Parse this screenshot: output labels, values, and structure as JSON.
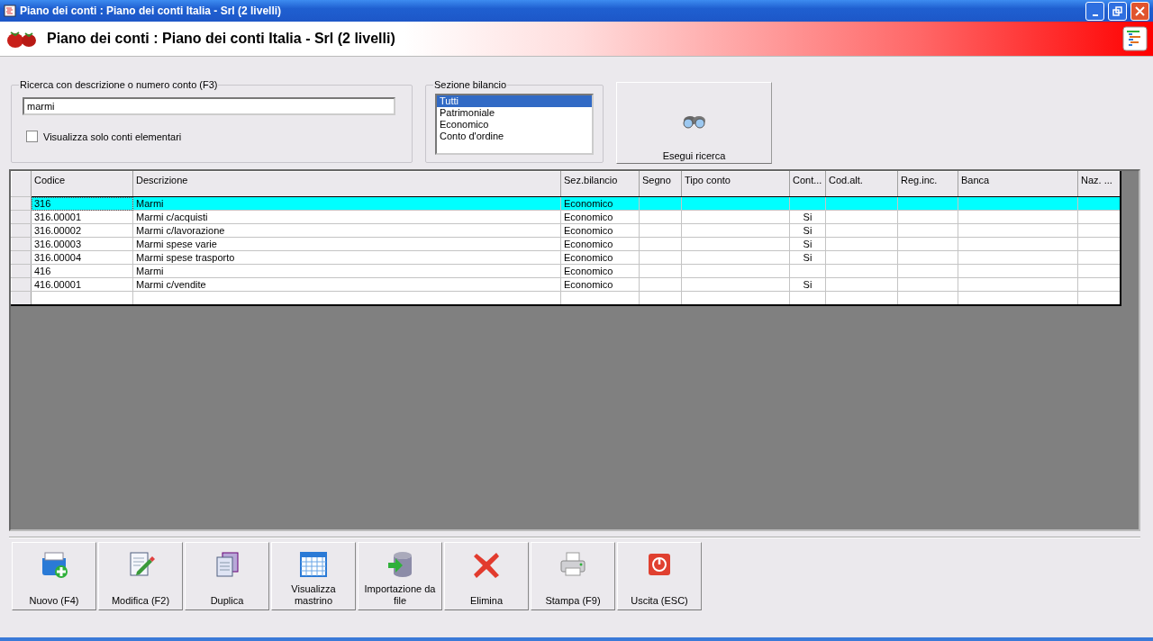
{
  "window": {
    "title": "Piano dei conti : Piano dei conti Italia - Srl (2 livelli)"
  },
  "header": {
    "title": "Piano dei conti : Piano dei conti Italia - Srl (2 livelli)"
  },
  "search": {
    "label": "Ricerca con descrizione o numero conto (F3)",
    "value": "marmi",
    "checkbox": {
      "label": "Visualizza solo conti elementari",
      "checked": false
    }
  },
  "section": {
    "label": "Sezione bilancio",
    "options": [
      {
        "label": "Tutti",
        "selected": true
      },
      {
        "label": "Patrimoniale",
        "selected": false
      },
      {
        "label": "Economico",
        "selected": false
      },
      {
        "label": "Conto d'ordine",
        "selected": false
      }
    ]
  },
  "search_button": {
    "label": "Esegui ricerca"
  },
  "table": {
    "columns": [
      "Codice",
      "Descrizione",
      "Sez.bilancio",
      "Segno",
      "Tipo conto",
      "Cont...",
      "Cod.alt.",
      "Reg.inc.",
      "Banca",
      "Naz. ..."
    ],
    "rows": [
      {
        "selected": true,
        "cells": [
          "316",
          "Marmi",
          "Economico",
          null,
          null,
          null,
          null,
          null,
          null,
          null
        ]
      },
      {
        "selected": false,
        "cells": [
          "316.00001",
          "Marmi c/acquisti",
          "Economico",
          null,
          null,
          "Si",
          null,
          null,
          null,
          null
        ]
      },
      {
        "selected": false,
        "cells": [
          "316.00002",
          "Marmi c/lavorazione",
          "Economico",
          null,
          null,
          "Si",
          null,
          null,
          null,
          null
        ]
      },
      {
        "selected": false,
        "cells": [
          "316.00003",
          "Marmi spese varie",
          "Economico",
          null,
          null,
          "Si",
          null,
          null,
          null,
          null
        ]
      },
      {
        "selected": false,
        "cells": [
          "316.00004",
          "Marmi spese trasporto",
          "Economico",
          null,
          null,
          "Si",
          null,
          null,
          null,
          null
        ]
      },
      {
        "selected": false,
        "cells": [
          "416",
          "Marmi",
          "Economico",
          null,
          null,
          null,
          null,
          null,
          null,
          null
        ]
      },
      {
        "selected": false,
        "cells": [
          "416.00001",
          "Marmi c/vendite",
          "Economico",
          null,
          null,
          "Si",
          null,
          null,
          null,
          null
        ]
      }
    ]
  },
  "toolbar": [
    {
      "kind": "new",
      "label": "Nuovo (F4)"
    },
    {
      "kind": "edit",
      "label": "Modifica (F2)"
    },
    {
      "kind": "copy",
      "label": "Duplica"
    },
    {
      "kind": "calendar",
      "label": "Visualizza mastrino"
    },
    {
      "kind": "import",
      "label": "Importazione da file"
    },
    {
      "kind": "delete",
      "label": "Elimina"
    },
    {
      "kind": "print",
      "label": "Stampa (F9)"
    },
    {
      "kind": "exit",
      "label": "Uscita (ESC)"
    }
  ]
}
